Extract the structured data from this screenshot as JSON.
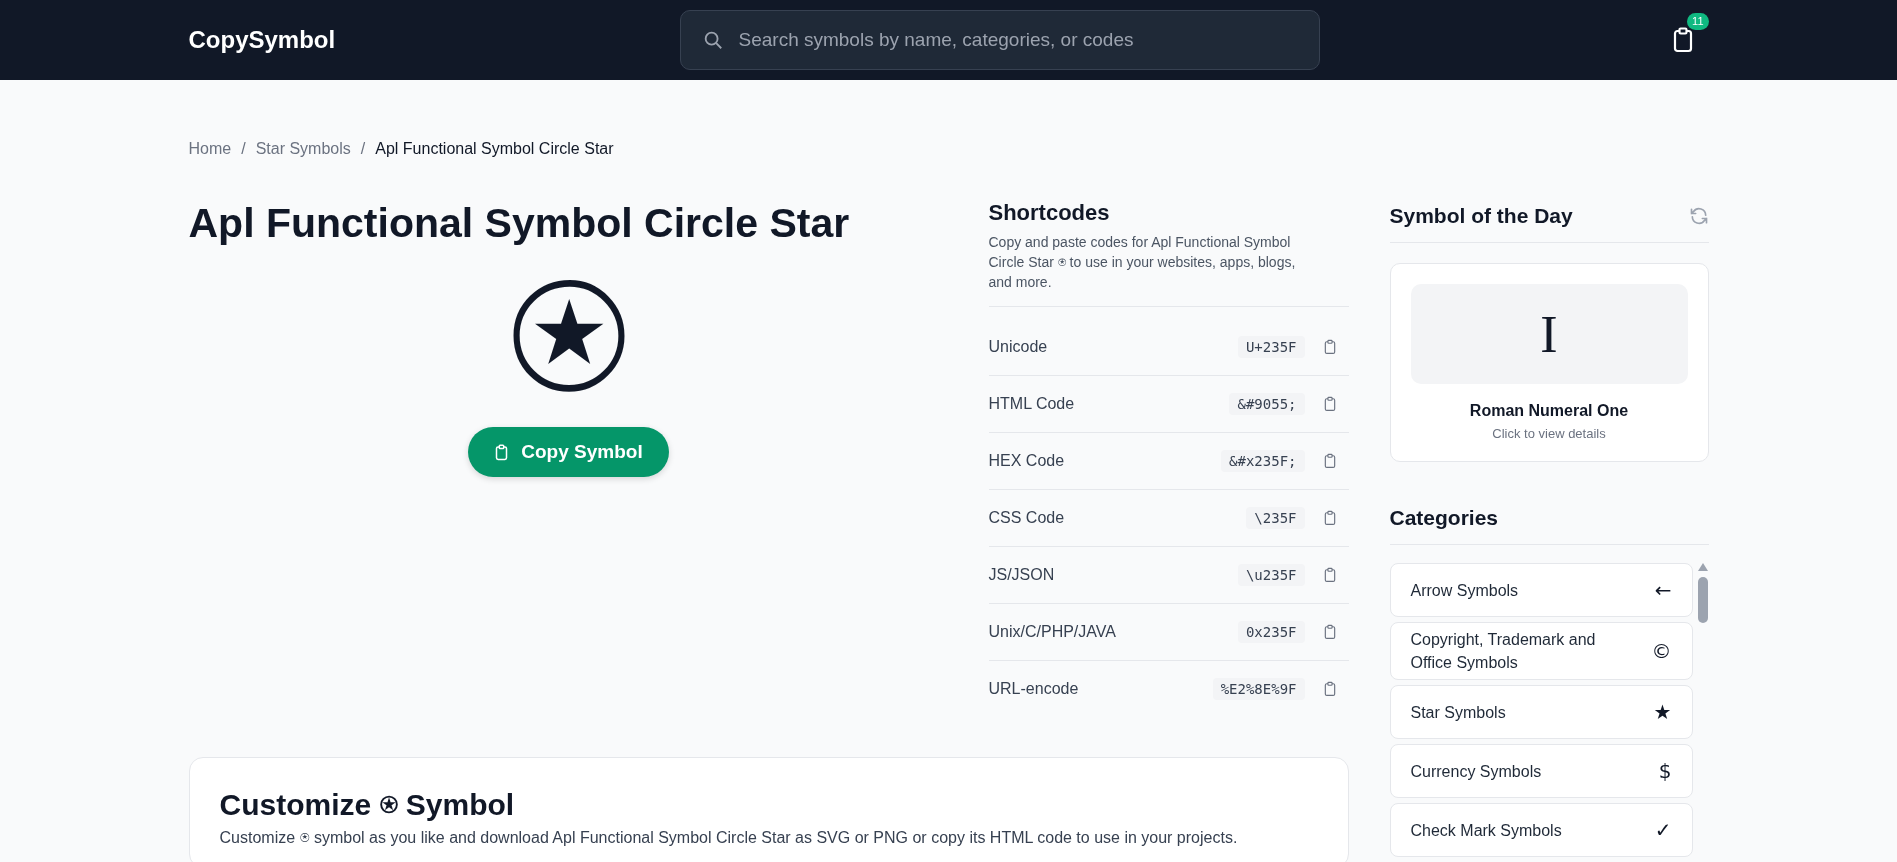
{
  "header": {
    "logo": "CopySymbol",
    "search": {
      "placeholder": "Search symbols by name, categories, or codes"
    },
    "clipboard_count": "11"
  },
  "breadcrumb": {
    "items": [
      "Home",
      "Star Symbols",
      "Apl Functional Symbol Circle Star"
    ],
    "separators": [
      "/",
      "/"
    ]
  },
  "title": "Apl Functional Symbol Circle Star",
  "symbol": "⍟",
  "copy_button": "Copy Symbol",
  "shortcodes": {
    "title": "Shortcodes",
    "description": "Copy and paste codes for Apl Functional Symbol Circle Star ⍟ to use in your websites, apps, blogs, and more.",
    "rows": [
      {
        "label": "Unicode",
        "code": "U+235F"
      },
      {
        "label": "HTML Code",
        "code": "&#9055;"
      },
      {
        "label": "HEX Code",
        "code": "&#x235F;"
      },
      {
        "label": "CSS Code",
        "code": "\\235F"
      },
      {
        "label": "JS/JSON",
        "code": "\\u235F"
      },
      {
        "label": "Unix/C/PHP/JAVA",
        "code": "0x235F"
      },
      {
        "label": "URL-encode",
        "code": "%E2%8E%9F"
      }
    ]
  },
  "customize": {
    "title": "Customize ⍟ Symbol",
    "description": "Customize ⍟ symbol as you like and download Apl Functional Symbol Circle Star as SVG or PNG or copy its HTML code to use in your projects."
  },
  "symbol_of_the_day": {
    "title": "Symbol of the Day",
    "symbol": "I",
    "name": "Roman Numeral One",
    "hint": "Click to view details"
  },
  "categories": {
    "title": "Categories",
    "items": [
      {
        "name": "Arrow Symbols",
        "symbol": "←"
      },
      {
        "name": "Copyright, Trademark and Office Symbols",
        "symbol": "©"
      },
      {
        "name": "Star Symbols",
        "symbol": "★"
      },
      {
        "name": "Currency Symbols",
        "symbol": "$"
      },
      {
        "name": "Check Mark Symbols",
        "symbol": "✓"
      }
    ]
  }
}
